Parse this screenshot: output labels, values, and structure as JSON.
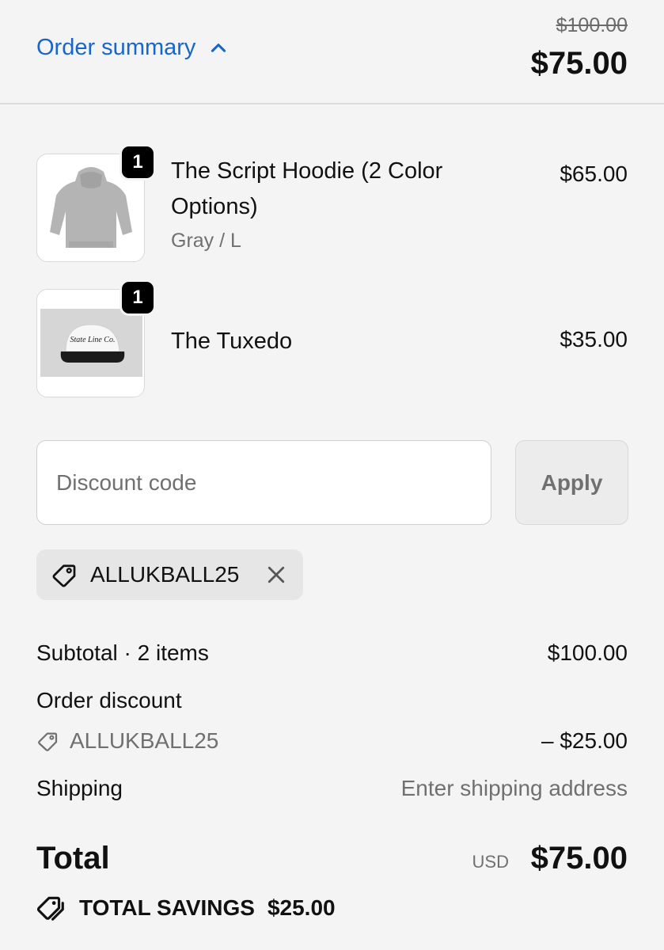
{
  "header": {
    "toggle_label": "Order summary",
    "original_price": "$100.00",
    "total": "$75.00"
  },
  "items": [
    {
      "qty": "1",
      "name_line1": "The Script Hoodie (2 Color",
      "name_line2": "Options)",
      "variant": "Gray / L",
      "price": "$65.00",
      "image": "gray-hoodie"
    },
    {
      "qty": "1",
      "name_line1": "The Tuxedo",
      "price": "$35.00",
      "image": "white-cap",
      "image_text": "State Line Co."
    }
  ],
  "discount": {
    "placeholder": "Discount code",
    "apply_label": "Apply",
    "applied_code": "ALLUKBALL25"
  },
  "summary": {
    "subtotal_label": "Subtotal · 2 items",
    "subtotal_value": "$100.00",
    "discount_label": "Order discount",
    "discount_code": "ALLUKBALL25",
    "discount_value": "– $25.00",
    "shipping_label": "Shipping",
    "shipping_value": "Enter shipping address",
    "total_label": "Total",
    "currency": "USD",
    "total_value": "$75.00",
    "savings_label": "TOTAL SAVINGS",
    "savings_value": "$25.00"
  },
  "colors": {
    "link": "#1a66c7",
    "background": "#f4f4f4"
  }
}
